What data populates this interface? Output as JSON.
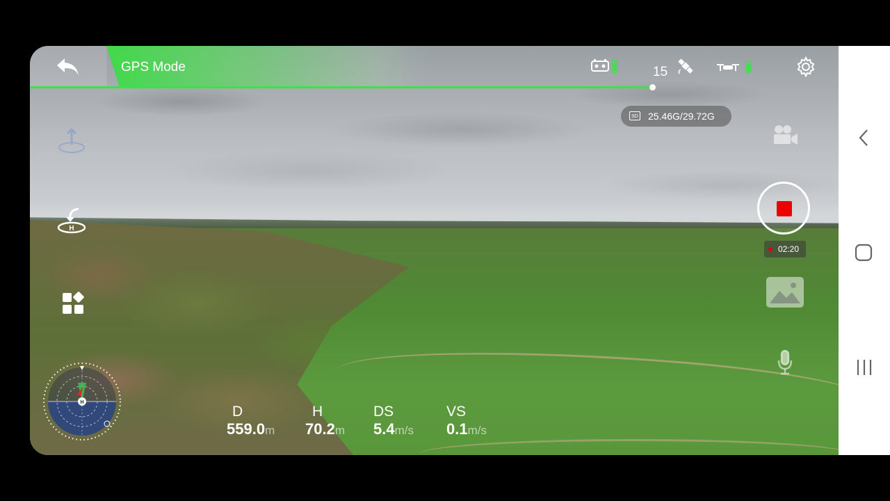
{
  "topbar": {
    "mode": "GPS Mode",
    "satellite_count": "15",
    "icons": {
      "back": "back-arrow-icon",
      "remote": "remote-controller-battery-icon",
      "satellite": "satellite-icon",
      "drone": "drone-battery-icon",
      "settings": "gear-icon"
    }
  },
  "storage": {
    "value": "25.46G/29.72G",
    "icon": "sd-card-icon"
  },
  "recording": {
    "time": "02:20",
    "state_color": "#e00000"
  },
  "telemetry": {
    "distance": {
      "key": "D",
      "value": "559.0",
      "unit": "m"
    },
    "height": {
      "key": "H",
      "value": "70.2",
      "unit": "m"
    },
    "horizontal_speed": {
      "key": "DS",
      "value": "5.4",
      "unit": "m/s"
    },
    "vertical_speed": {
      "key": "VS",
      "value": "0.1",
      "unit": "m/s"
    }
  },
  "left_tools": [
    "takeoff-land-icon",
    "return-home-icon",
    "apps-grid-icon"
  ],
  "right_tools": [
    "video-camera-icon",
    "record-button",
    "gallery-icon",
    "microphone-icon"
  ],
  "radar": {
    "home_label": "H",
    "icon": "compass-radar-icon"
  },
  "colors": {
    "accent_green": "#3ee04b",
    "record_red": "#e00000"
  },
  "navbar": [
    "back-nav-icon",
    "home-nav-icon",
    "recents-nav-icon"
  ]
}
